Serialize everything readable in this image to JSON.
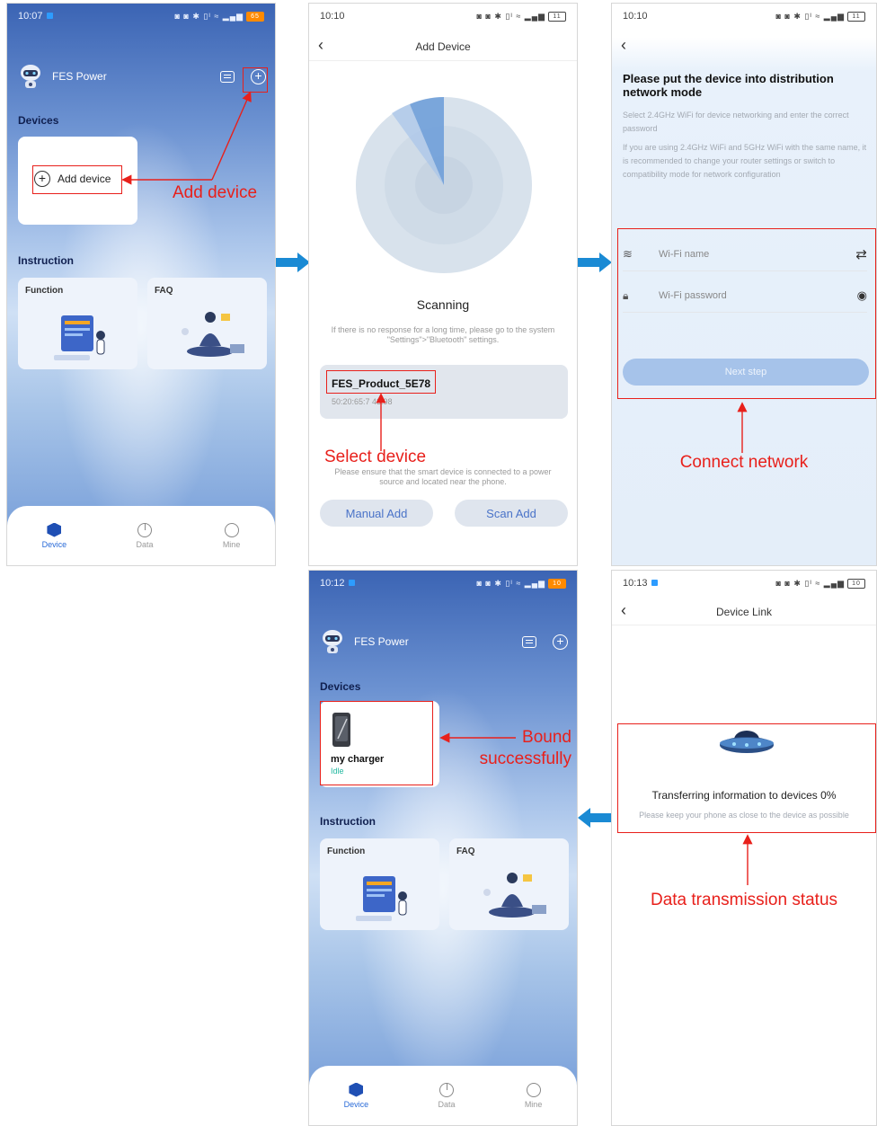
{
  "screen1": {
    "time": "10:07",
    "battery": "65",
    "brand": "FES Power",
    "devices_label": "Devices",
    "add_device_label": "Add device",
    "instruction_label": "Instruction",
    "function_label": "Function",
    "faq_label": "FAQ",
    "annotation": "Add device"
  },
  "screen2": {
    "time": "10:10",
    "battery": "11",
    "title": "Add Device",
    "scanning": "Scanning",
    "hint_line1": "If there is no response for a long time, please go to the system",
    "hint_line2": "\"Settings\">\"Bluetooth\" settings.",
    "device_name": "FES_Product_5E78",
    "device_mac": "50:20:65:7 43:98",
    "annotation": "Select device",
    "ensure_line1": "Please ensure that the smart device is connected to a power",
    "ensure_line2": "source and located near the phone.",
    "manual_add": "Manual Add",
    "scan_add": "Scan Add"
  },
  "screen3": {
    "time": "10:10",
    "battery": "11",
    "heading": "Please put the device into distribution network mode",
    "desc1": "Select 2.4GHz WiFi for device networking and enter the correct password",
    "desc2": "If you are using 2.4GHz WiFi and 5GHz WiFi with the same name, it is recommended to change your router settings or switch to compatibility mode for network configuration",
    "wifi_placeholder": "Wi-Fi name",
    "password_placeholder": "Wi-Fi password",
    "next_step": "Next step",
    "annotation": "Connect network"
  },
  "screen4": {
    "time": "10:12",
    "battery": "10",
    "brand": "FES Power",
    "devices_label": "Devices",
    "charger_name": "my charger",
    "charger_status": "Idle",
    "instruction_label": "Instruction",
    "function_label": "Function",
    "faq_label": "FAQ",
    "annotation_line1": "Bound",
    "annotation_line2": "successfully"
  },
  "screen5": {
    "time": "10:13",
    "battery": "10",
    "title": "Device Link",
    "transfer_text": "Transferring information to devices 0%",
    "keep_text": "Please keep your phone as close to the device as possible",
    "annotation": "Data transmission status"
  },
  "tabs": {
    "device": "Device",
    "data": "Data",
    "mine": "Mine"
  },
  "status_icons": "◙ ◙ ✱ ▯ᴵ ≈ ▂▄▆",
  "colors": {
    "accent": "#2a6bd8",
    "annotation_red": "#e8201b",
    "arrow_blue": "#1a8ad4"
  }
}
